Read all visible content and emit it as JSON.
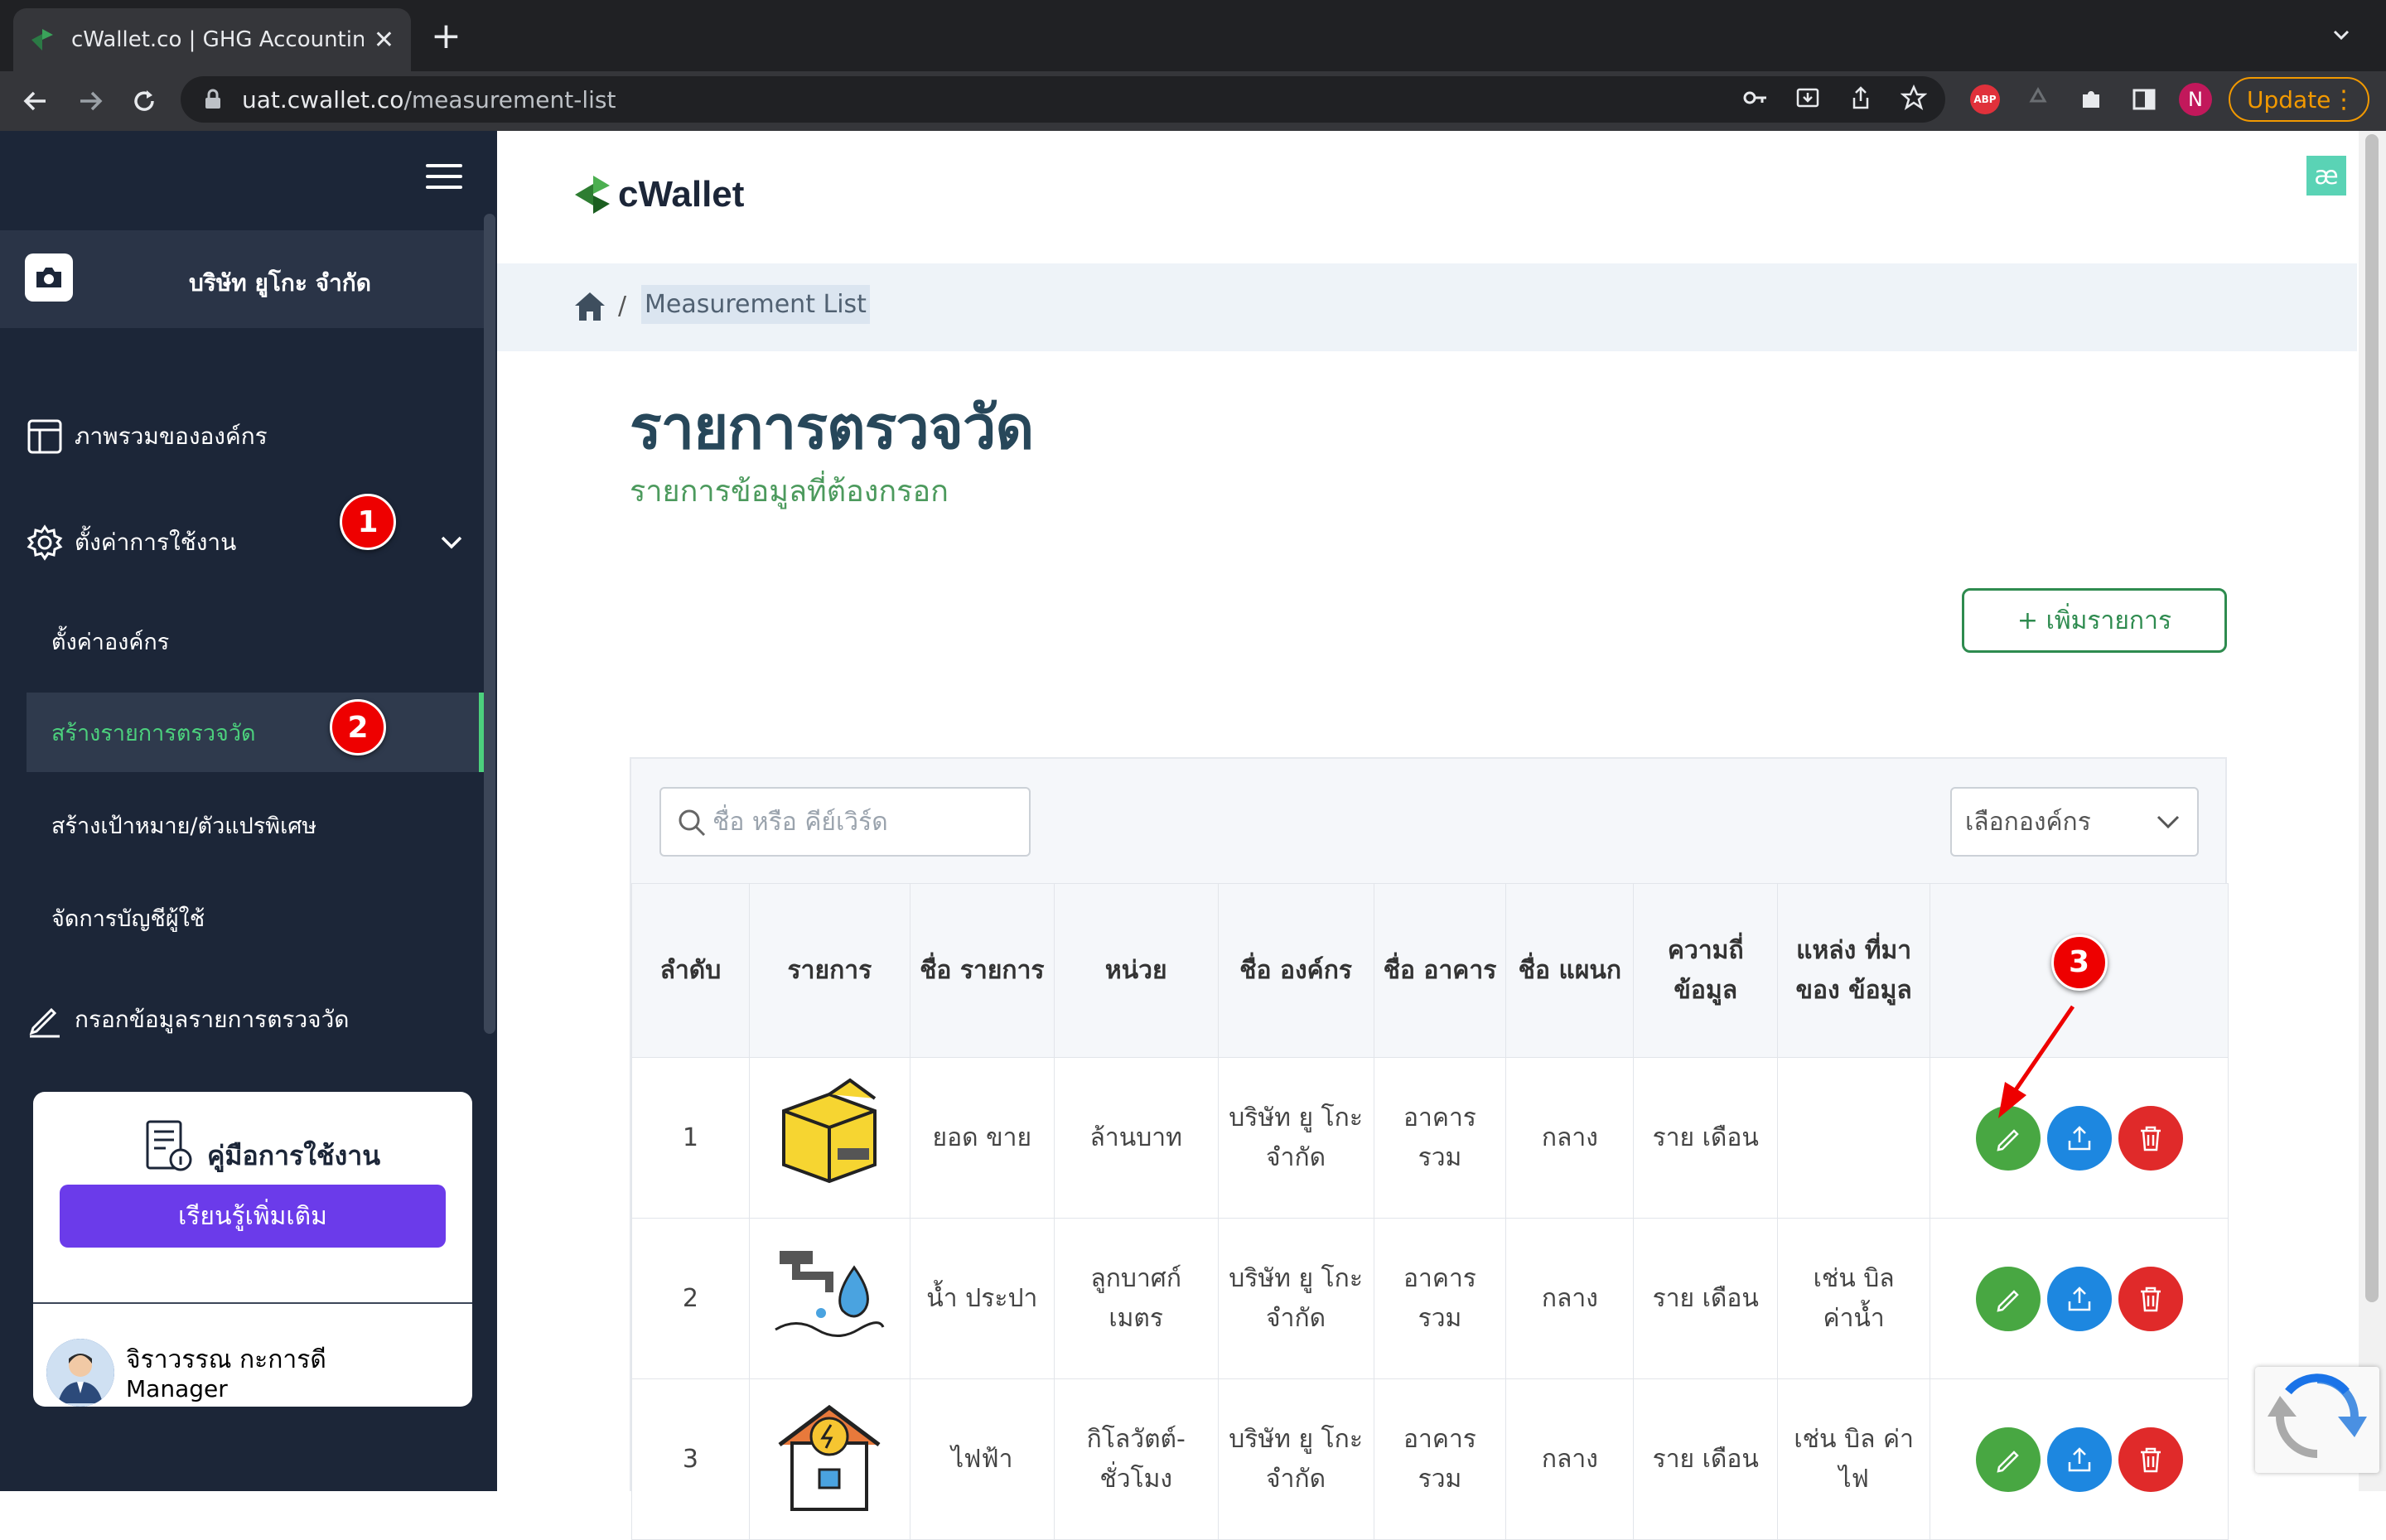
{
  "browser": {
    "tab_title": "cWallet.co | GHG Accounting S",
    "url_domain": "uat.cwallet.co",
    "url_path": "/measurement-list",
    "update_label": "Update",
    "profile_initial": "N",
    "abp_label": "ABP"
  },
  "sidebar": {
    "company": "บริษัท ยูโกะ จำกัด",
    "items": [
      {
        "label": "ภาพรวมขององค์กร",
        "icon": "layout-icon"
      },
      {
        "label": "ตั้งค่าการใช้งาน",
        "icon": "gear-icon"
      },
      {
        "label": "กรอกข้อมูลรายการตรวจวัด",
        "icon": "pencil-icon"
      }
    ],
    "subitems": [
      {
        "label": "ตั้งค่าองค์กร"
      },
      {
        "label": "สร้างรายการตรวจวัด"
      },
      {
        "label": "สร้างเป้าหมาย/ตัวแปรพิเศษ"
      },
      {
        "label": "จัดการบัญชีผู้ใช้"
      }
    ],
    "guide_title": "คู่มือการใช้งาน",
    "guide_button": "เรียนรู้เพิ่มเติม",
    "user_name": "จิราวรรณ กะการดี",
    "user_role": "Manager"
  },
  "annotations": [
    "1",
    "2",
    "3"
  ],
  "main": {
    "logo_text": "cWallet",
    "breadcrumb": "Measurement List",
    "title": "รายการตรวจวัด",
    "subtitle": "รายการข้อมูลที่ต้องกรอก",
    "add_button": "+ เพิ่มรายการ",
    "search_placeholder": "ชื่อ หรือ คีย์เวิร์ด",
    "org_select": "เลือกองค์กร",
    "columns": [
      "ลำดับ",
      "รายการ",
      "ชื่อ รายการ",
      "หน่วย",
      "ชื่อ องค์กร",
      "ชื่อ อาคาร",
      "ชื่อ แผนก",
      "ความถี่ ข้อมูล",
      "แหล่ง ที่มาของ ข้อมูล"
    ],
    "rows": [
      {
        "no": "1",
        "name": "ยอด ขาย",
        "unit": "ล้านบาท",
        "org": "บริษัท ยู โกะ จำกัด",
        "building": "อาคาร รวม",
        "dept": "กลาง",
        "freq": "ราย เดือน",
        "source": "",
        "image": "box-icon"
      },
      {
        "no": "2",
        "name": "น้ำ ประปา",
        "unit": "ลูกบาศก์ เมตร",
        "org": "บริษัท ยู โกะ จำกัด",
        "building": "อาคาร รวม",
        "dept": "กลาง",
        "freq": "ราย เดือน",
        "source": "เช่น บิล ค่าน้ำ",
        "image": "water-tap-icon"
      },
      {
        "no": "3",
        "name": "ไฟฟ้า",
        "unit": "กิโลวัตต์- ชั่วโมง",
        "org": "บริษัท ยู โกะ จำกัด",
        "building": "อาคาร รวม",
        "dept": "กลาง",
        "freq": "ราย เดือน",
        "source": "เช่น บิล ค่าไฟ",
        "image": "electricity-icon"
      }
    ]
  },
  "colors": {
    "sidebar": "#1c2638",
    "accent_green": "#4cd07d",
    "primary_purple": "#6b3bea",
    "edit": "#48a742",
    "upload": "#1d87e0",
    "delete": "#e02a2a"
  }
}
